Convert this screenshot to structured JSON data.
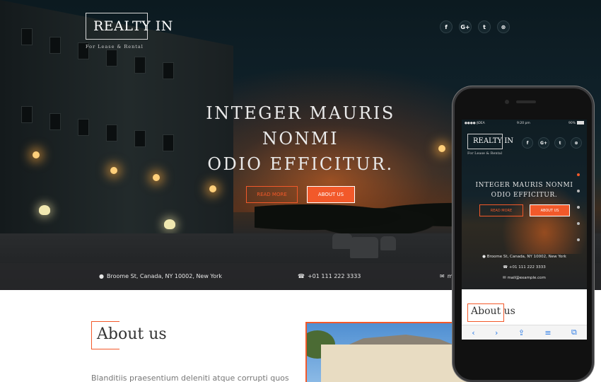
{
  "site": {
    "logo": "REALTY IN",
    "tagline": "For Lease & Rental"
  },
  "social": [
    {
      "icon": "facebook-icon",
      "glyph": "f"
    },
    {
      "icon": "google-plus-icon",
      "glyph": "G+"
    },
    {
      "icon": "twitter-icon",
      "glyph": "t"
    },
    {
      "icon": "dribbble-icon",
      "glyph": "⊛"
    }
  ],
  "hero": {
    "line1": "INTEGER MAURIS",
    "line2": "NONMI",
    "line3": "ODIO EFFICITUR.",
    "read_more": "READ MORE",
    "about_us_btn": "ABOUT US"
  },
  "contact": {
    "address": "Broome St, Canada, NY 10002, New York",
    "phone": "+01 111 222 3333",
    "email": "m"
  },
  "about": {
    "title": "About us",
    "text": "Blanditiis praesentium deleniti atque corrupti quos"
  },
  "phone_screen": {
    "carrier": "IDEA",
    "time": "9:20 pm",
    "battery": "90%",
    "logo": "REALTY IN",
    "tagline": "For Lease & Rental",
    "headline_1": "INTEGER MAURIS NONMI",
    "headline_2": "ODIO EFFICITUR.",
    "read_more": "READ MORE",
    "about_us_btn": "ABOUT US",
    "address": "Broome St, Canada, NY 10002, New York",
    "phone": "+01 111 222 3333",
    "email": "mail@example.com",
    "about_title": "About us"
  },
  "colors": {
    "accent": "#f2592a"
  }
}
